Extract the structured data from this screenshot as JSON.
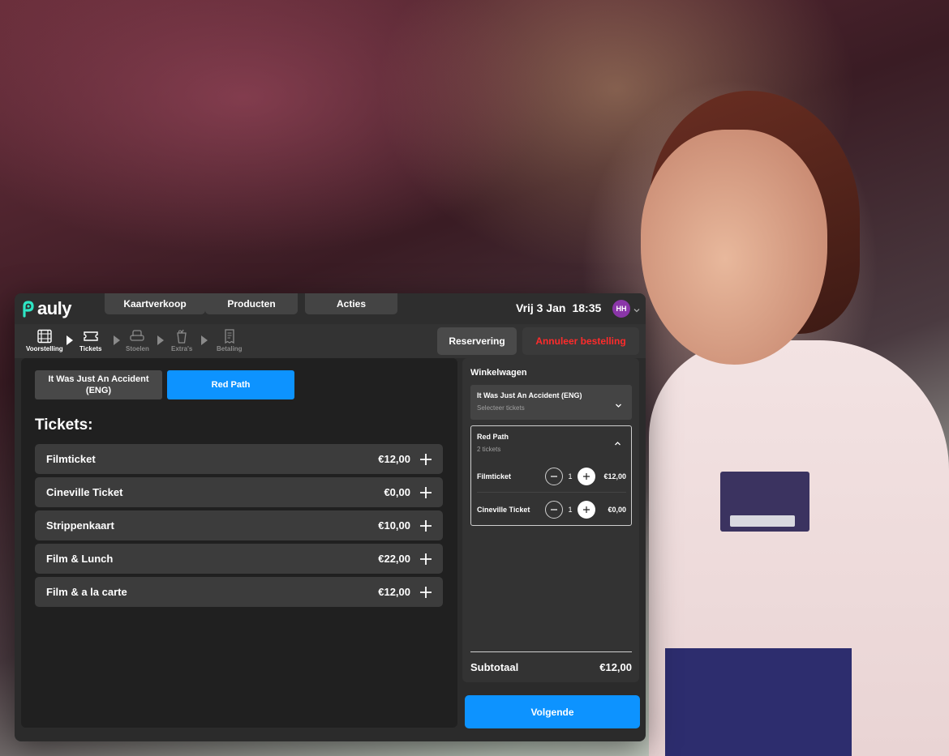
{
  "brand": {
    "name": "auly",
    "accent": "#0d93ff",
    "logo_color": "#2ee6c5"
  },
  "nav": {
    "tabs": [
      {
        "label": "Kaartverkoop"
      },
      {
        "label": "Producten"
      },
      {
        "label": "Acties"
      }
    ]
  },
  "header": {
    "date": "Vrij 3 Jan",
    "time": "18:35",
    "user_initials": "HH"
  },
  "steps": [
    {
      "label": "Voorstelling",
      "icon": "film-icon",
      "state": "active"
    },
    {
      "label": "Tickets",
      "icon": "ticket-icon",
      "state": "active"
    },
    {
      "label": "Stoelen",
      "icon": "seat-icon",
      "state": "inactive"
    },
    {
      "label": "Extra's",
      "icon": "drink-icon",
      "state": "inactive"
    },
    {
      "label": "Betaling",
      "icon": "receipt-icon",
      "state": "inactive"
    }
  ],
  "actions": {
    "reservation_label": "Reservering",
    "cancel_label": "Annuleer bestelling",
    "next_label": "Volgende"
  },
  "films": [
    {
      "label": "It Was Just An Accident (ENG)",
      "selected": false
    },
    {
      "label": "Red Path",
      "selected": true
    }
  ],
  "tickets_heading": "Tickets:",
  "tickets": [
    {
      "name": "Filmticket",
      "price": "€12,00"
    },
    {
      "name": "Cineville Ticket",
      "price": "€0,00"
    },
    {
      "name": "Strippenkaart",
      "price": "€10,00"
    },
    {
      "name": "Film & Lunch",
      "price": "€22,00"
    },
    {
      "name": "Film & a la carte",
      "price": "€12,00"
    }
  ],
  "cart": {
    "title": "Winkelwagen",
    "groups": [
      {
        "title": "It Was Just An Accident (ENG)",
        "subtitle": "Selecteer tickets",
        "expanded": false
      },
      {
        "title": "Red Path",
        "subtitle": "2 tickets",
        "expanded": true,
        "lines": [
          {
            "name": "Filmticket",
            "qty": "1",
            "price": "€12,00"
          },
          {
            "name": "Cineville Ticket",
            "qty": "1",
            "price": "€0,00"
          }
        ]
      }
    ],
    "subtotal_label": "Subtotaal",
    "subtotal_value": "€12,00"
  }
}
